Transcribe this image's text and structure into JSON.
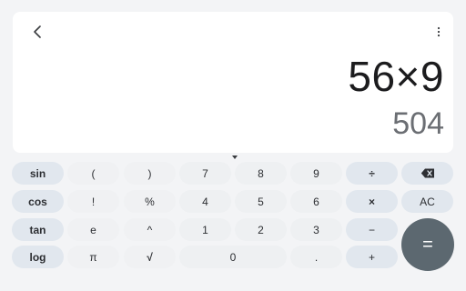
{
  "display": {
    "expression": "56×9",
    "result": "504"
  },
  "keys": {
    "sin": "sin",
    "cos": "cos",
    "tan": "tan",
    "log": "log",
    "open_paren": "(",
    "close_paren": ")",
    "factorial": "!",
    "percent": "%",
    "e": "e",
    "power": "^",
    "pi": "π",
    "sqrt": "√",
    "d7": "7",
    "d8": "8",
    "d9": "9",
    "d4": "4",
    "d5": "5",
    "d6": "6",
    "d1": "1",
    "d2": "2",
    "d3": "3",
    "d0": "0",
    "dot": ".",
    "divide": "÷",
    "multiply": "×",
    "minus": "−",
    "plus": "+",
    "clear": "AC",
    "equals": "="
  },
  "icons": {
    "back": "chevron-left-icon",
    "more": "more-vertical-icon",
    "backspace": "backspace-icon",
    "handle": "drag-handle-icon"
  },
  "colors": {
    "background": "#F3F4F6",
    "display_bg": "#FFFFFF",
    "function_key": "#E1E7EE",
    "digit_key": "#EEF0F2",
    "equals_key": "#5C6870"
  }
}
